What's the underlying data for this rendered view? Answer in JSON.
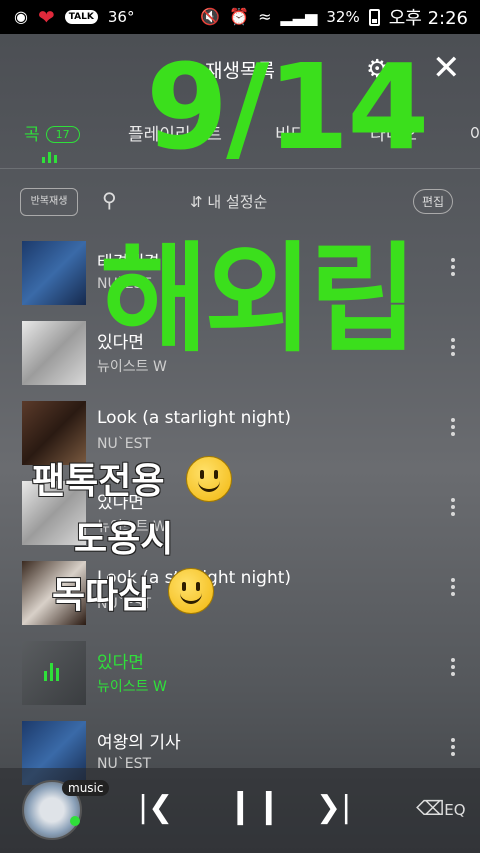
{
  "status_bar": {
    "temperature": "36°",
    "battery_percent": "32%",
    "time": "오후 2:26",
    "talk_label": "TALK"
  },
  "header": {
    "title": "재생목록"
  },
  "tabs": [
    {
      "label": "곡",
      "badge": "17",
      "active": true
    },
    {
      "label": "플레이리스트"
    },
    {
      "label": "비디오"
    },
    {
      "label": "라디오"
    },
    {
      "label": "아"
    }
  ],
  "toolbar": {
    "repeat_label": "반복재생",
    "sort_label": "내 설정순",
    "edit_label": "편집"
  },
  "songs": [
    {
      "title": "태격태격",
      "artist": "NU`EST"
    },
    {
      "title": "있다면",
      "artist": "뉴이스트 W"
    },
    {
      "title": "Look (a starlight night)",
      "artist": "NU`EST"
    },
    {
      "title": "있다면",
      "artist": "뉴이스트 W"
    },
    {
      "title": "Look (a starlight night)",
      "artist": "NU`EST"
    },
    {
      "title": "있다면",
      "artist": "뉴이스트 W",
      "playing": true
    },
    {
      "title": "여왕의 기사",
      "artist": "NU`EST"
    }
  ],
  "overlay": {
    "date": "9/14",
    "handwritten": "해외립",
    "line1": "팬톡전용",
    "line2": "도용시",
    "line3": "목따삼"
  },
  "player": {
    "music_label": "music",
    "eq_label": "EQ"
  },
  "colors": {
    "accent": "#2fe03a",
    "overlay_green": "#3bdf1c"
  }
}
